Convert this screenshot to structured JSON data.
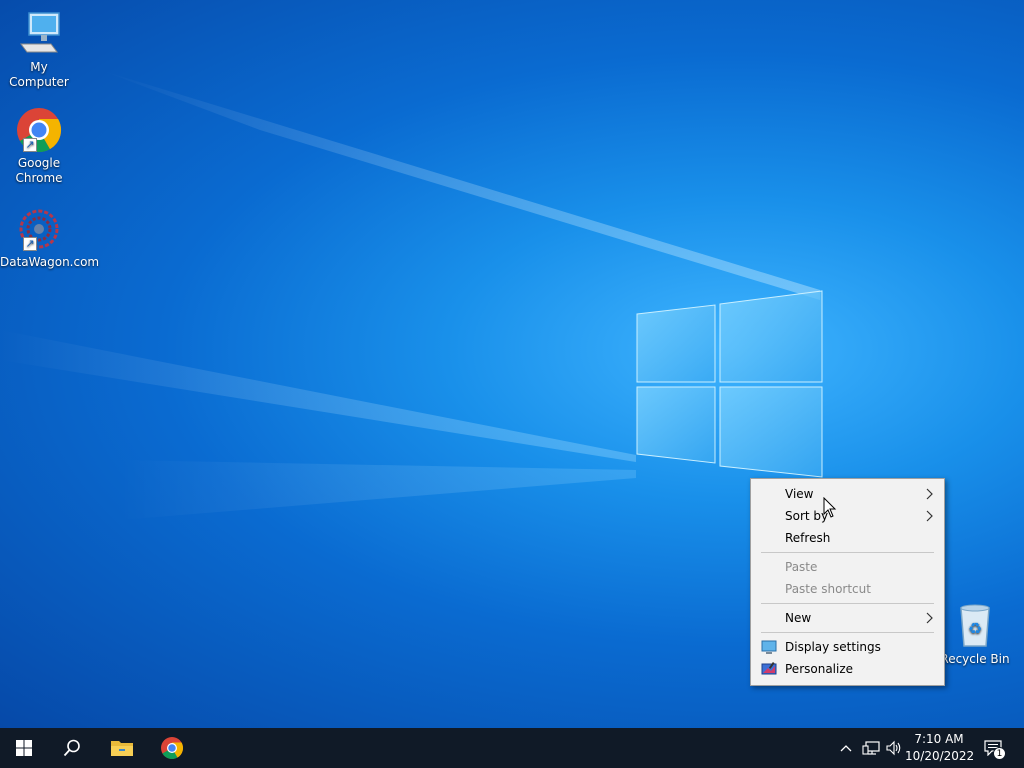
{
  "desktop": {
    "icons": [
      {
        "label": "My Computer",
        "icon": "computer-icon"
      },
      {
        "label": "Google Chrome",
        "icon": "chrome-icon"
      },
      {
        "label": "DataWagon.com",
        "icon": "datawagon-icon"
      },
      {
        "label": "Recycle Bin",
        "icon": "recycle-bin-icon"
      }
    ]
  },
  "context_menu": {
    "items": [
      {
        "label": "View",
        "submenu": true,
        "disabled": false
      },
      {
        "label": "Sort by",
        "submenu": true,
        "disabled": false
      },
      {
        "label": "Refresh",
        "submenu": false,
        "disabled": false
      },
      {
        "label": "Paste",
        "submenu": false,
        "disabled": true
      },
      {
        "label": "Paste shortcut",
        "submenu": false,
        "disabled": true
      },
      {
        "label": "New",
        "submenu": true,
        "disabled": false
      },
      {
        "label": "Display settings",
        "icon": "display-settings-icon",
        "disabled": false
      },
      {
        "label": "Personalize",
        "icon": "personalize-icon",
        "disabled": false
      }
    ]
  },
  "taskbar": {
    "buttons": [
      "start-icon",
      "search-icon",
      "file-explorer-icon",
      "chrome-icon"
    ],
    "tray": [
      "chevron-up-icon",
      "network-icon",
      "volume-icon"
    ],
    "clock": {
      "time": "7:10 AM",
      "date": "10/20/2022"
    },
    "notification_count": "1"
  },
  "colors": {
    "taskbar_bg": "#101a27",
    "menu_bg": "#f2f2f2",
    "desktop_accent": "#0a6bd1"
  }
}
